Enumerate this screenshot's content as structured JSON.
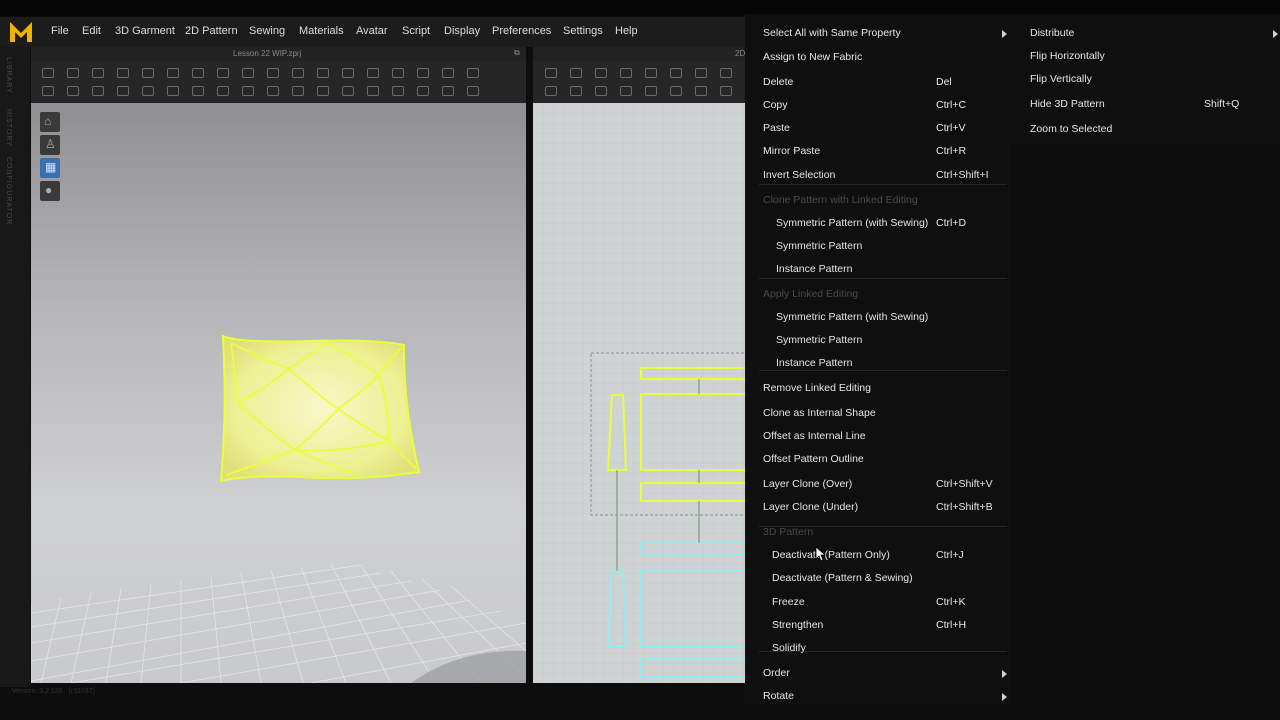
{
  "app": {
    "logo_letter": "M",
    "accent": "#f0b400"
  },
  "menu": [
    "File",
    "Edit",
    "3D Garment",
    "2D Pattern",
    "Sewing",
    "Materials",
    "Avatar",
    "Script",
    "Display",
    "Preferences",
    "Settings",
    "Help"
  ],
  "left_rail": [
    "LIBRARY",
    "HISTORY",
    "CONFIGURATOR"
  ],
  "tabs": {
    "left_title": "Lesson 22 WIP.zprj",
    "right_title": "2D"
  },
  "context_menu": {
    "items": [
      {
        "label": "Select All with Same Property",
        "submenu": true
      },
      {
        "label": "Assign to New Fabric"
      },
      {
        "label": "Delete",
        "shortcut": "Del"
      },
      {
        "label": "Copy",
        "shortcut": "Ctrl+C"
      },
      {
        "label": "Paste",
        "shortcut": "Ctrl+V"
      },
      {
        "label": "Mirror Paste",
        "shortcut": "Ctrl+R"
      },
      {
        "label": "Invert Selection",
        "shortcut": "Ctrl+Shift+I"
      },
      {
        "label": "Clone Pattern with Linked Editing",
        "disabled": true
      },
      {
        "label": "Symmetric Pattern (with Sewing)",
        "shortcut": "Ctrl+D",
        "indent": true
      },
      {
        "label": "Symmetric Pattern",
        "indent": true
      },
      {
        "label": "Instance Pattern",
        "indent": true
      },
      {
        "label": "Apply Linked Editing",
        "disabled": true
      },
      {
        "label": "Symmetric Pattern (with Sewing)",
        "indent": true
      },
      {
        "label": "Symmetric Pattern",
        "indent": true
      },
      {
        "label": "Instance Pattern",
        "indent": true
      },
      {
        "label": "Remove Linked Editing"
      },
      {
        "label": "Clone as Internal Shape"
      },
      {
        "label": "Offset as Internal Line"
      },
      {
        "label": "Offset Pattern Outline"
      },
      {
        "label": "Layer Clone (Over)",
        "shortcut": "Ctrl+Shift+V"
      },
      {
        "label": "Layer Clone (Under)",
        "shortcut": "Ctrl+Shift+B"
      },
      {
        "label": "3D Pattern",
        "disabled": true
      },
      {
        "label": "Deactivate (Pattern Only)",
        "shortcut": "Ctrl+J",
        "indent2": true
      },
      {
        "label": "Deactivate (Pattern & Sewing)",
        "indent2": true
      },
      {
        "label": "Freeze",
        "shortcut": "Ctrl+K",
        "indent2": true
      },
      {
        "label": "Strengthen",
        "shortcut": "Ctrl+H",
        "indent2": true
      },
      {
        "label": "Solidify",
        "indent2": true
      },
      {
        "label": "Order",
        "submenu": true
      },
      {
        "label": "Rotate",
        "submenu": true
      }
    ]
  },
  "submenu": {
    "items": [
      {
        "label": "Distribute",
        "submenu": true
      },
      {
        "label": "Flip Horizontally"
      },
      {
        "label": "Flip Vertically"
      },
      {
        "label": "Hide 3D Pattern",
        "shortcut": "Shift+Q"
      },
      {
        "label": "Zoom to Selected"
      }
    ]
  },
  "status": {
    "version": "Version: 3.2.126",
    "build": "(r31037)"
  },
  "colors": {
    "pattern_selected": "#e8ff3a",
    "pattern_inactive": "#8ef0f0",
    "pillow_fill": "#f3f5b0"
  }
}
